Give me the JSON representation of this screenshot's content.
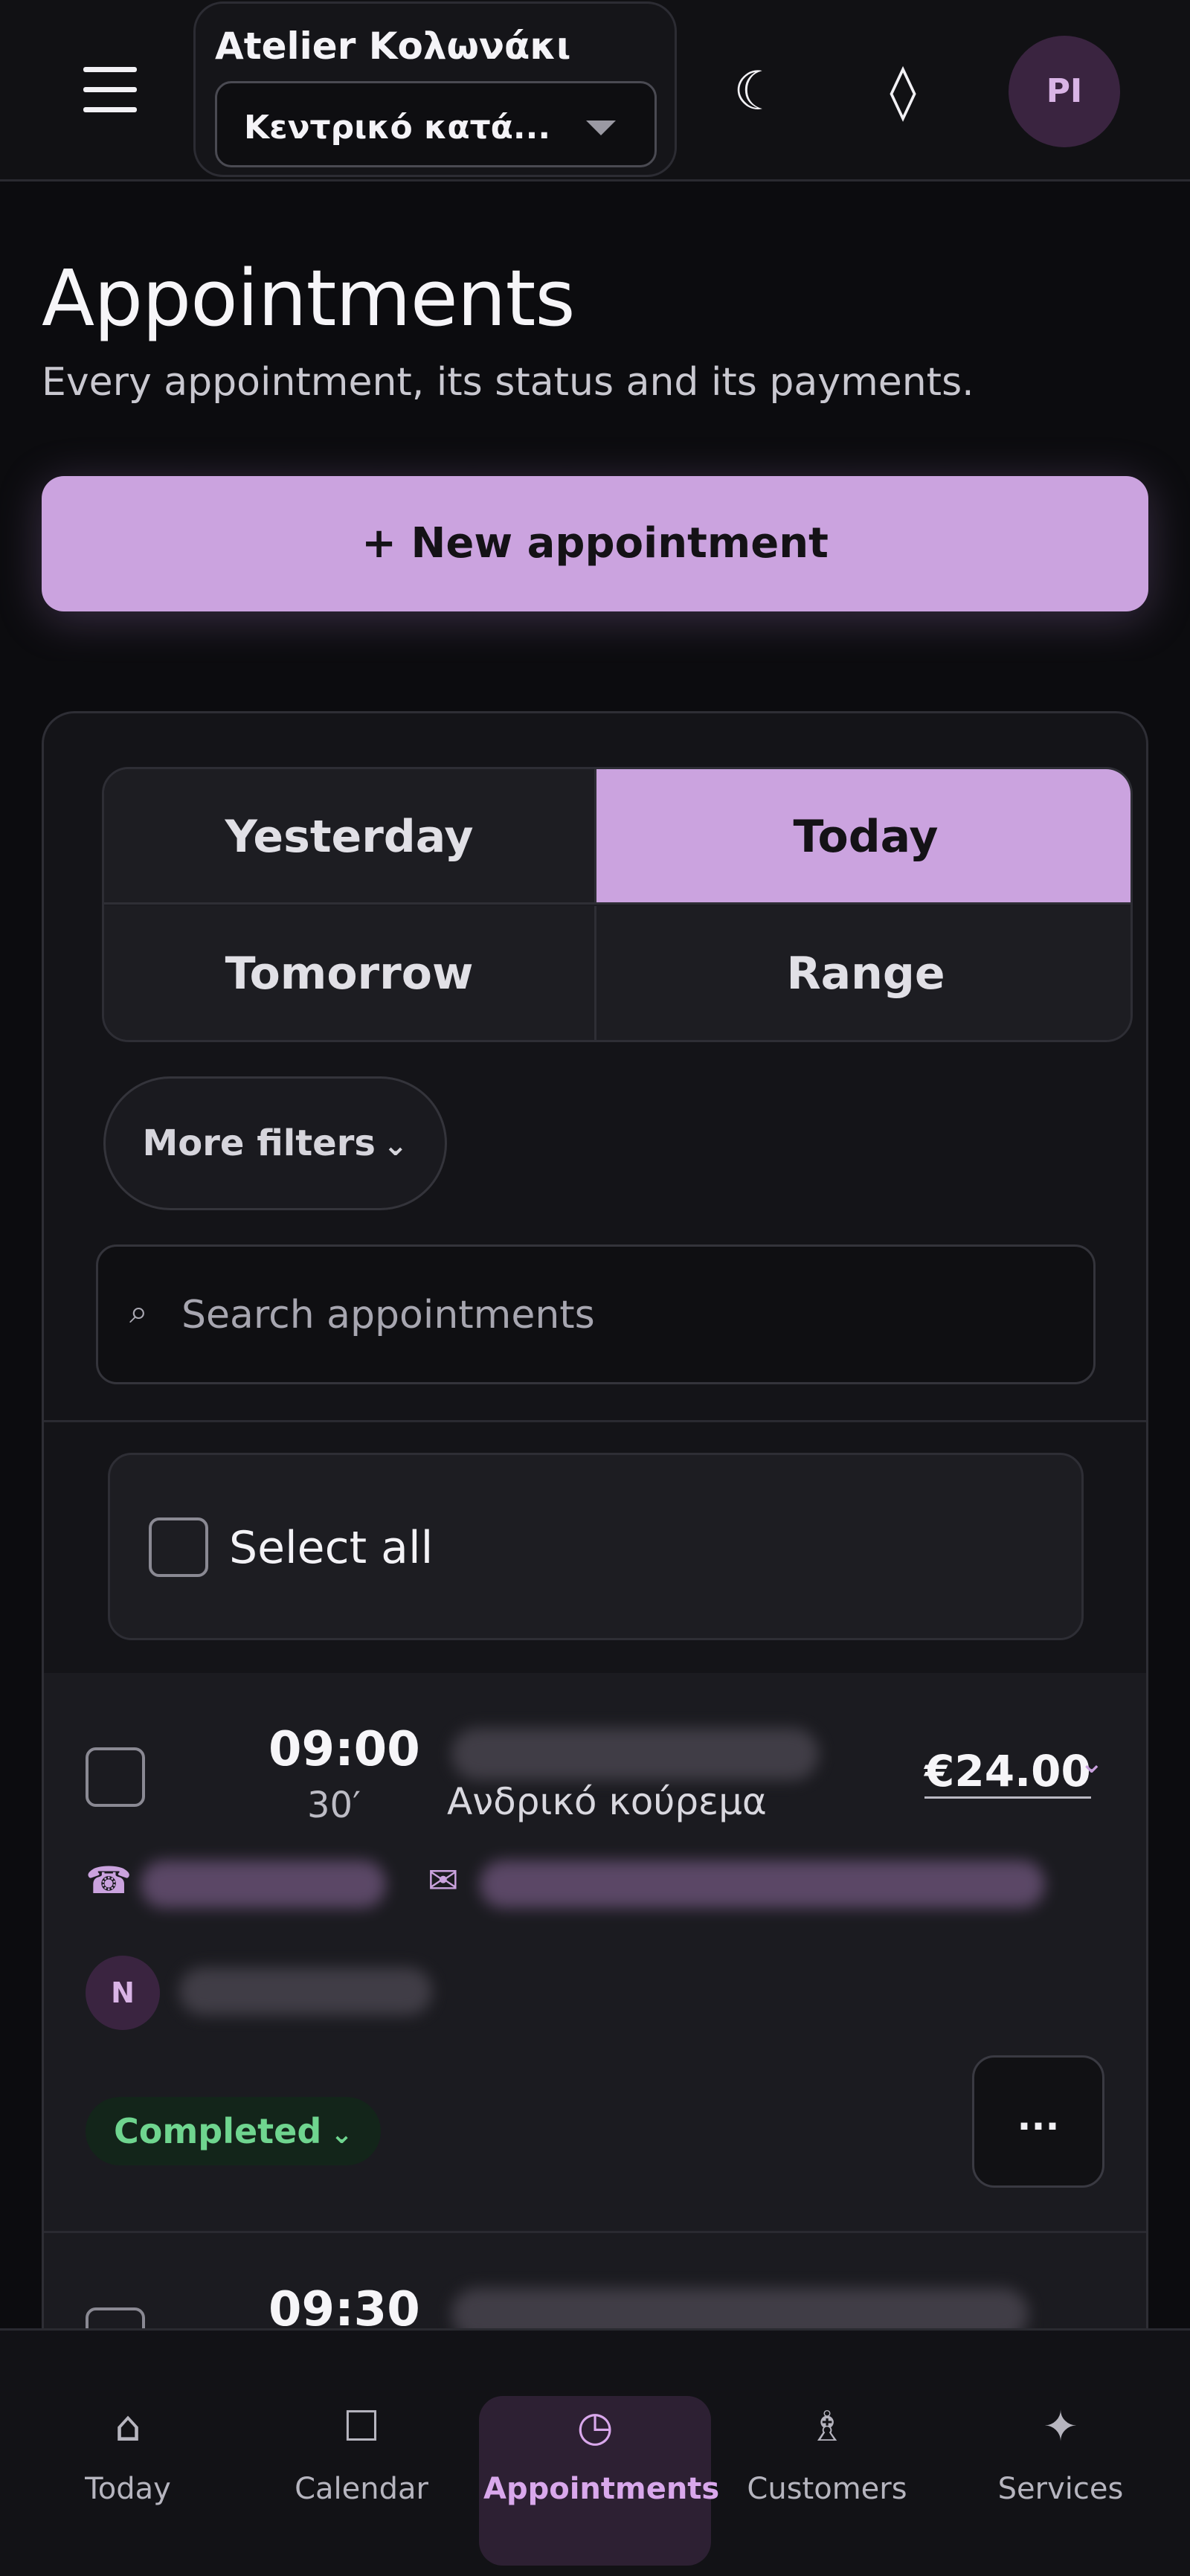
{
  "header": {
    "salon_name": "Atelier Κολωνάκι",
    "branch_value": "Κεντρικό κατά...",
    "theme_icon": "moon-icon",
    "diamond_icon": "diamond-icon",
    "avatar_initials": "PI"
  },
  "page": {
    "title": "Appointments",
    "subtitle": "Every appointment, its status and its payments.",
    "new_button": "+ New appointment"
  },
  "filters": {
    "segments": [
      "Yesterday",
      "Today",
      "Tomorrow",
      "Range"
    ],
    "active_segment": "Today",
    "more_filters": "More filters",
    "search_placeholder": "Search appointments"
  },
  "list": {
    "select_all": "Select all",
    "appointments": [
      {
        "time": "09:00",
        "duration": "30′",
        "service": "Ανδρικό κούρεμα",
        "price": "€24.00",
        "staff_initial": "N",
        "status": "Completed",
        "more": "..."
      },
      {
        "time": "09:30"
      }
    ]
  },
  "nav": {
    "items": [
      {
        "label": "Today",
        "icon": "home-icon"
      },
      {
        "label": "Calendar",
        "icon": "calendar-icon"
      },
      {
        "label": "Appointments",
        "icon": "clock-icon"
      },
      {
        "label": "Customers",
        "icon": "person-icon"
      },
      {
        "label": "Services",
        "icon": "sparkle-icon"
      }
    ],
    "active": "Appointments"
  },
  "colors": {
    "accent": "#cba3df",
    "background": "#0c0c0f",
    "status_completed": "#6fd58f"
  }
}
